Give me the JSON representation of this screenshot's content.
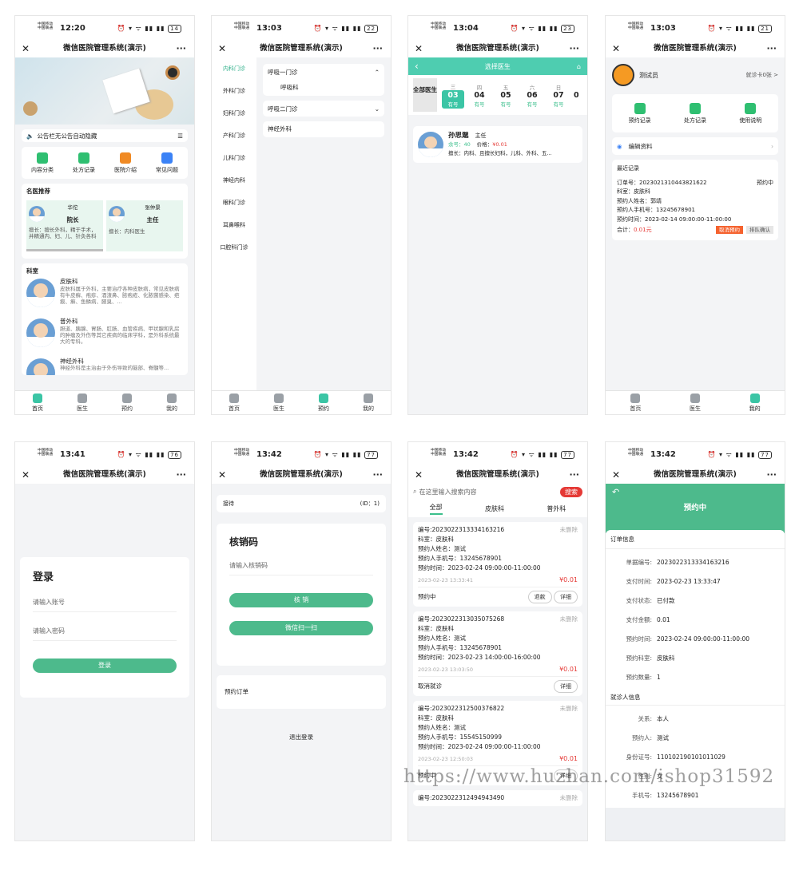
{
  "app_title": "微信医院管理系统(演示)",
  "carrier": [
    "中国移动",
    "中国联通"
  ],
  "times": [
    "12:20",
    "13:03",
    "13:04",
    "13:03",
    "13:41",
    "13:42",
    "13:42",
    "13:42"
  ],
  "battery": [
    "14",
    "22",
    "23",
    "21",
    "76",
    "77",
    "77",
    "77"
  ],
  "tabs": [
    "首页",
    "医生",
    "预约",
    "我的"
  ],
  "home": {
    "notice": "公告栏无公告自动隐藏",
    "quick": [
      "内容分类",
      "处方记录",
      "医院介绍",
      "常见问题"
    ],
    "quick_colors": [
      "#2fbf71",
      "#2fbf71",
      "#f08a24",
      "#3b82f6"
    ],
    "doctors_title": "名医推荐",
    "doctors": [
      {
        "name": "华佗",
        "title": "院长",
        "desc": "擅长：擅长外科，精于手术，并精通内、妇、儿、针灸各科"
      },
      {
        "name": "张仲景",
        "title": "主任",
        "desc": "擅长：内科医生"
      }
    ],
    "dept_title": "科室",
    "depts": [
      {
        "name": "皮肤科",
        "desc": "皮肤科属于外科，主要治疗各种皮肤病，常见皮肤病有牛皮癣、疱疹、酒渣鼻、脓疱疮、化脓菌感染、疤痕、癣、鱼鳞病、腋臭、..."
      },
      {
        "name": "普外科",
        "desc": "胆道、胰腺、胃肠、肛肠、血管疾病、甲状腺和乳房的肿瘤及外伤等其它疾病的临床学科，是外科系统最大的专科。"
      },
      {
        "name": "神经外科",
        "desc": "神经外科是主治由于外伤导致的脑部、脊髓等..."
      }
    ]
  },
  "depts_page": {
    "side": [
      "内科门诊",
      "外科门诊",
      "妇科门诊",
      "产科门诊",
      "儿科门诊",
      "神经内科",
      "眼科门诊",
      "耳鼻喉科",
      "口腔科门诊"
    ],
    "groups": [
      {
        "title": "呼吸一门诊",
        "items": [
          "呼吸科"
        ],
        "open": "⌃"
      },
      {
        "title": "呼吸二门诊",
        "items": [],
        "open": "⌄"
      }
    ],
    "extra": "神经外科"
  },
  "choose": {
    "title": "选择医生",
    "all": "全部医生",
    "days": [
      {
        "w": "三",
        "d": "03",
        "s": "有号"
      },
      {
        "w": "四",
        "d": "04",
        "s": "有号"
      },
      {
        "w": "五",
        "d": "05",
        "s": "有号"
      },
      {
        "w": "六",
        "d": "06",
        "s": "有号"
      },
      {
        "w": "日",
        "d": "07",
        "s": "有号"
      },
      {
        "w": "",
        "d": "0",
        "s": ""
      }
    ],
    "doctor": {
      "name": "孙思邈",
      "title": "主任",
      "remain": "余号：40",
      "price_label": "价格：",
      "price": "¥0.01",
      "desc": "擅长：内科、且擅长妇科，儿科、外科、五..."
    }
  },
  "mine": {
    "user": "测试员",
    "card": "就诊卡0张 >",
    "icons": [
      "预约记录",
      "处方记录",
      "使用说明"
    ],
    "edit": "编辑资料",
    "recent": "最近记录",
    "order_no": "订单号：2023021310443821622",
    "status": "预约中",
    "lines": [
      "科室：皮肤科",
      "预约人姓名：郭靖",
      "预约人手机号：13245678901",
      "预约时间：2023-02-14 09:00:00-11:00:00"
    ],
    "total_label": "合计：",
    "total": "0.01元",
    "cancel": "取消预约",
    "queue": "排队确认"
  },
  "login": {
    "title": "登录",
    "account": "请输入账号",
    "password": "请输入密码",
    "button": "登录"
  },
  "verify": {
    "top": "接待",
    "id": "(ID：1)",
    "title": "核销码",
    "input": "请输入核销码",
    "btn1": "核  销",
    "btn2": "微信扫一扫",
    "orders": "预约订单",
    "logout": "退出登录"
  },
  "orders": {
    "search": "在这里输入搜索内容",
    "search_btn": "搜索",
    "tabs": [
      "全部",
      "皮肤科",
      "普外科"
    ],
    "list": [
      {
        "no": "编号:2023022313334163216",
        "del": "未删除",
        "lines": [
          "科室：皮肤科",
          "预约人姓名：测试",
          "预约人手机号：13245678901",
          "预约时间：2023-02-24 09:00:00-11:00:00"
        ],
        "date": "2023-02-23 13:33:41",
        "price": "¥0.01",
        "status": "预约中",
        "btns": [
          "退款",
          "详细"
        ]
      },
      {
        "no": "编号:2023022313035075268",
        "del": "未删除",
        "lines": [
          "科室：皮肤科",
          "预约人姓名：测试",
          "预约人手机号：13245678901",
          "预约时间：2023-02-23 14:00:00-16:00:00"
        ],
        "date": "2023-02-23 13:03:50",
        "price": "¥0.01",
        "status": "取消就诊",
        "btns": [
          "详细"
        ]
      },
      {
        "no": "编号:2023022312500376822",
        "del": "未删除",
        "lines": [
          "科室：皮肤科",
          "预约人姓名：测试",
          "预约人手机号：15545150999",
          "预约时间：2023-02-24 09:00:00-11:00:00"
        ],
        "date": "2023-02-23 12:50:03",
        "price": "¥0.01",
        "status": "预约中",
        "btns": [
          "详细"
        ]
      },
      {
        "no": "编号:2023022312494943490",
        "del": "未删除",
        "lines": [],
        "date": "",
        "price": "",
        "status": "",
        "btns": []
      }
    ]
  },
  "detail": {
    "title": "预约中",
    "order_section": "订单信息",
    "order_rows": [
      [
        "单据编号:",
        "2023022313334163216"
      ],
      [
        "支付时间:",
        "2023-02-23 13:33:47"
      ],
      [
        "支付状态:",
        "已付款"
      ],
      [
        "支付金额:",
        "0.01"
      ],
      [
        "预约时间:",
        "2023-02-24 09:00:00-11:00:00"
      ],
      [
        "预约科室:",
        "皮肤科"
      ],
      [
        "预约数量:",
        "1"
      ]
    ],
    "patient_section": "就诊人信息",
    "patient_rows": [
      [
        "关系:",
        "本人"
      ],
      [
        "预约人:",
        "测试"
      ],
      [
        "身份证号:",
        "110102190101011029"
      ],
      [
        "性别:",
        "女"
      ],
      [
        "手机号:",
        "13245678901"
      ]
    ]
  },
  "watermark": "https://www.huzhan.com/ishop31592",
  "colors": {
    "accent": "#4dba8c",
    "teal": "#3bc5a5",
    "red": "#e53935",
    "orange": "#f5622e"
  }
}
